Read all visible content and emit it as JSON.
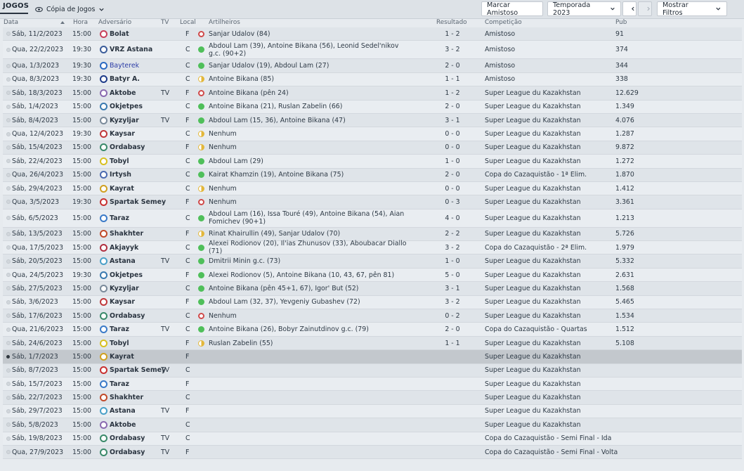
{
  "header": {
    "title": "JOGOS",
    "view_label": "Cópia de Jogos",
    "btn_friendly": "Marcar Amistoso",
    "btn_season": "Temporada 2023",
    "btn_filters": "Mostrar Filtros"
  },
  "columns": {
    "date": "Data",
    "time": "Hora",
    "opponent": "Adversário",
    "tv": "TV",
    "local": "Local",
    "scorers": "Artilheiros",
    "result": "Resultado",
    "competition": "Competição",
    "attendance": "Pub"
  },
  "colors": {
    "win": "#4fbf5a",
    "loss": "#d04a4a",
    "draw": "#e3b73a",
    "link": "#2c3da6"
  },
  "matches": [
    {
      "date": "Sáb, 11/2/2023",
      "time": "15:00",
      "opponent": "Bolat",
      "tv": "",
      "local": "F",
      "res": "loss",
      "scorers": "Sanjar Udalov (84)",
      "result": "1 - 2",
      "competition": "Amistoso",
      "pub": "91",
      "crest": "#c8405a"
    },
    {
      "date": "Qua, 22/2/2023",
      "time": "19:30",
      "opponent": "VRZ Astana",
      "tv": "",
      "local": "C",
      "res": "win",
      "scorers": "Abdoul Lam (39), Antoine Bikana (56), Leonid Sedel'nikov g.c. (90+2)",
      "result": "3 - 2",
      "competition": "Amistoso",
      "pub": "374",
      "crest": "#3a5c9a",
      "tall": true
    },
    {
      "date": "Qua, 1/3/2023",
      "time": "19:30",
      "opponent": "Bayterek",
      "tv": "",
      "local": "C",
      "res": "win",
      "scorers": "Sanjar Udalov (19), Abdoul Lam (27)",
      "result": "2 - 0",
      "competition": "Amistoso",
      "pub": "344",
      "crest": "#2a6ac2",
      "link": true
    },
    {
      "date": "Qua, 8/3/2023",
      "time": "19:30",
      "opponent": "Batyr A.",
      "tv": "",
      "local": "C",
      "res": "draw",
      "scorers": "Antoine Bikana (85)",
      "result": "1 - 1",
      "competition": "Amistoso",
      "pub": "338",
      "crest": "#1e3c8a"
    },
    {
      "date": "Sáb, 18/3/2023",
      "time": "15:00",
      "opponent": "Aktobe",
      "tv": "TV",
      "local": "F",
      "res": "loss",
      "scorers": "Antoine Bikana (pên 24)",
      "result": "1 - 2",
      "competition": "Super League du Kazakhstan",
      "pub": "12.629",
      "crest": "#8a6ab0"
    },
    {
      "date": "Sáb, 1/4/2023",
      "time": "15:00",
      "opponent": "Okjetpes",
      "tv": "",
      "local": "C",
      "res": "win",
      "scorers": "Antoine Bikana (21), Ruslan Zabelin (66)",
      "result": "2 - 0",
      "competition": "Super League du Kazakhstan",
      "pub": "1.349",
      "crest": "#3a7ab0"
    },
    {
      "date": "Sáb, 8/4/2023",
      "time": "15:00",
      "opponent": "Kyzyljar",
      "tv": "TV",
      "local": "F",
      "res": "win",
      "scorers": "Abdoul Lam (15, 36), Antoine Bikana (47)",
      "result": "3 - 1",
      "competition": "Super League du Kazakhstan",
      "pub": "4.076",
      "crest": "#7a8a9a"
    },
    {
      "date": "Qua, 12/4/2023",
      "time": "19:30",
      "opponent": "Kaysar",
      "tv": "",
      "local": "C",
      "res": "draw",
      "scorers": "Nenhum",
      "result": "0 - 0",
      "competition": "Super League du Kazakhstan",
      "pub": "1.287",
      "crest": "#c0383a"
    },
    {
      "date": "Sáb, 15/4/2023",
      "time": "15:00",
      "opponent": "Ordabasy",
      "tv": "",
      "local": "F",
      "res": "draw",
      "scorers": "Nenhum",
      "result": "0 - 0",
      "competition": "Super League du Kazakhstan",
      "pub": "9.872",
      "crest": "#3a8a6a"
    },
    {
      "date": "Sáb, 22/4/2023",
      "time": "15:00",
      "opponent": "Tobyl",
      "tv": "",
      "local": "C",
      "res": "win",
      "scorers": "Abdoul Lam (29)",
      "result": "1 - 0",
      "competition": "Super League du Kazakhstan",
      "pub": "1.272",
      "crest": "#d8c020"
    },
    {
      "date": "Qua, 26/4/2023",
      "time": "15:00",
      "opponent": "Irtysh",
      "tv": "",
      "local": "C",
      "res": "win",
      "scorers": "Kairat Khamzin (19), Antoine Bikana (75)",
      "result": "2 - 0",
      "competition": "Copa do Cazaquistão - 1ª Elim.",
      "pub": "1.870",
      "crest": "#4a6ab0"
    },
    {
      "date": "Sáb, 29/4/2023",
      "time": "15:00",
      "opponent": "Kayrat",
      "tv": "",
      "local": "C",
      "res": "draw",
      "scorers": "Nenhum",
      "result": "0 - 0",
      "competition": "Super League du Kazakhstan",
      "pub": "1.412",
      "crest": "#d0a020"
    },
    {
      "date": "Qua, 3/5/2023",
      "time": "19:30",
      "opponent": "Spartak Semey",
      "tv": "",
      "local": "F",
      "res": "loss",
      "scorers": "Nenhum",
      "result": "0 - 3",
      "competition": "Super League du Kazakhstan",
      "pub": "3.361",
      "crest": "#c83030"
    },
    {
      "date": "Sáb, 6/5/2023",
      "time": "15:00",
      "opponent": "Taraz",
      "tv": "",
      "local": "C",
      "res": "win",
      "scorers": "Abdoul Lam (16), Issa Touré (49), Antoine Bikana (54), Aian Fomichev (90+1)",
      "result": "4 - 0",
      "competition": "Super League du Kazakhstan",
      "pub": "1.213",
      "crest": "#3a7ac8",
      "tall": true
    },
    {
      "date": "Sáb, 13/5/2023",
      "time": "15:00",
      "opponent": "Shakhter",
      "tv": "",
      "local": "F",
      "res": "draw",
      "scorers": "Rinat Khairullin (49), Sanjar Udalov (70)",
      "result": "2 - 2",
      "competition": "Super League du Kazakhstan",
      "pub": "5.726",
      "crest": "#c04a2a"
    },
    {
      "date": "Qua, 17/5/2023",
      "time": "15:00",
      "opponent": "Akjayyk",
      "tv": "",
      "local": "C",
      "res": "win",
      "scorers": "Alexei Rodionov (20), Il'ias Zhunusov (33), Aboubacar Diallo (71)",
      "result": "3 - 2",
      "competition": "Copa do Cazaquistão - 2ª Elim.",
      "pub": "1.979",
      "crest": "#b03040"
    },
    {
      "date": "Sáb, 20/5/2023",
      "time": "15:00",
      "opponent": "Astana",
      "tv": "TV",
      "local": "C",
      "res": "win",
      "scorers": "Dmitrii Minin g.c. (73)",
      "result": "1 - 0",
      "competition": "Super League du Kazakhstan",
      "pub": "5.332",
      "crest": "#4aa0c8"
    },
    {
      "date": "Qua, 24/5/2023",
      "time": "19:30",
      "opponent": "Okjetpes",
      "tv": "",
      "local": "F",
      "res": "win",
      "scorers": "Alexei Rodionov (5), Antoine Bikana (10, 43, 67, pên 81)",
      "result": "5 - 0",
      "competition": "Super League du Kazakhstan",
      "pub": "2.631",
      "crest": "#3a7ab0"
    },
    {
      "date": "Sáb, 27/5/2023",
      "time": "15:00",
      "opponent": "Kyzyljar",
      "tv": "",
      "local": "C",
      "res": "win",
      "scorers": "Antoine Bikana (pên 45+1, 67), Igor' But (52)",
      "result": "3 - 1",
      "competition": "Super League du Kazakhstan",
      "pub": "1.568",
      "crest": "#7a8a9a"
    },
    {
      "date": "Sáb, 3/6/2023",
      "time": "15:00",
      "opponent": "Kaysar",
      "tv": "",
      "local": "F",
      "res": "win",
      "scorers": "Abdoul Lam (32, 37), Yevgeniy Gubashev (72)",
      "result": "3 - 2",
      "competition": "Super League du Kazakhstan",
      "pub": "5.465",
      "crest": "#c0383a"
    },
    {
      "date": "Sáb, 17/6/2023",
      "time": "15:00",
      "opponent": "Ordabasy",
      "tv": "",
      "local": "C",
      "res": "loss",
      "scorers": "Nenhum",
      "result": "0 - 2",
      "competition": "Super League du Kazakhstan",
      "pub": "1.534",
      "crest": "#3a8a6a"
    },
    {
      "date": "Qua, 21/6/2023",
      "time": "15:00",
      "opponent": "Taraz",
      "tv": "TV",
      "local": "C",
      "res": "win",
      "scorers": "Antoine Bikana (26), Bobyr Zainutdinov g.c. (79)",
      "result": "2 - 0",
      "competition": "Copa do Cazaquistão - Quartas",
      "pub": "1.512",
      "crest": "#3a7ac8"
    },
    {
      "date": "Sáb, 24/6/2023",
      "time": "15:00",
      "opponent": "Tobyl",
      "tv": "",
      "local": "F",
      "res": "draw",
      "scorers": "Ruslan Zabelin (55)",
      "result": "1 - 1",
      "competition": "Super League du Kazakhstan",
      "pub": "5.108",
      "crest": "#d8c020"
    },
    {
      "date": "Sáb, 1/7/2023",
      "time": "15:00",
      "opponent": "Kayrat",
      "tv": "",
      "local": "F",
      "res": "",
      "scorers": "",
      "result": "",
      "competition": "Super League du Kazakhstan",
      "pub": "",
      "crest": "#d0a020",
      "current": true
    },
    {
      "date": "Sáb, 8/7/2023",
      "time": "15:00",
      "opponent": "Spartak Semey",
      "tv": "TV",
      "local": "C",
      "res": "",
      "scorers": "",
      "result": "",
      "competition": "Super League du Kazakhstan",
      "pub": "",
      "crest": "#c83030"
    },
    {
      "date": "Sáb, 15/7/2023",
      "time": "15:00",
      "opponent": "Taraz",
      "tv": "",
      "local": "F",
      "res": "",
      "scorers": "",
      "result": "",
      "competition": "Super League du Kazakhstan",
      "pub": "",
      "crest": "#3a7ac8"
    },
    {
      "date": "Sáb, 22/7/2023",
      "time": "15:00",
      "opponent": "Shakhter",
      "tv": "",
      "local": "C",
      "res": "",
      "scorers": "",
      "result": "",
      "competition": "Super League du Kazakhstan",
      "pub": "",
      "crest": "#c04a2a"
    },
    {
      "date": "Sáb, 29/7/2023",
      "time": "15:00",
      "opponent": "Astana",
      "tv": "TV",
      "local": "F",
      "res": "",
      "scorers": "",
      "result": "",
      "competition": "Super League du Kazakhstan",
      "pub": "",
      "crest": "#4aa0c8"
    },
    {
      "date": "Sáb, 5/8/2023",
      "time": "15:00",
      "opponent": "Aktobe",
      "tv": "",
      "local": "C",
      "res": "",
      "scorers": "",
      "result": "",
      "competition": "Super League du Kazakhstan",
      "pub": "",
      "crest": "#8a6ab0"
    },
    {
      "date": "Sáb, 19/8/2023",
      "time": "15:00",
      "opponent": "Ordabasy",
      "tv": "TV",
      "local": "C",
      "res": "",
      "scorers": "",
      "result": "",
      "competition": "Copa do Cazaquistão - Semi Final - Ida",
      "pub": "",
      "crest": "#3a8a6a"
    },
    {
      "date": "Qua, 27/9/2023",
      "time": "15:00",
      "opponent": "Ordabasy",
      "tv": "TV",
      "local": "F",
      "res": "",
      "scorers": "",
      "result": "",
      "competition": "Copa do Cazaquistão - Semi Final - Volta",
      "pub": "",
      "crest": "#3a8a6a"
    }
  ]
}
